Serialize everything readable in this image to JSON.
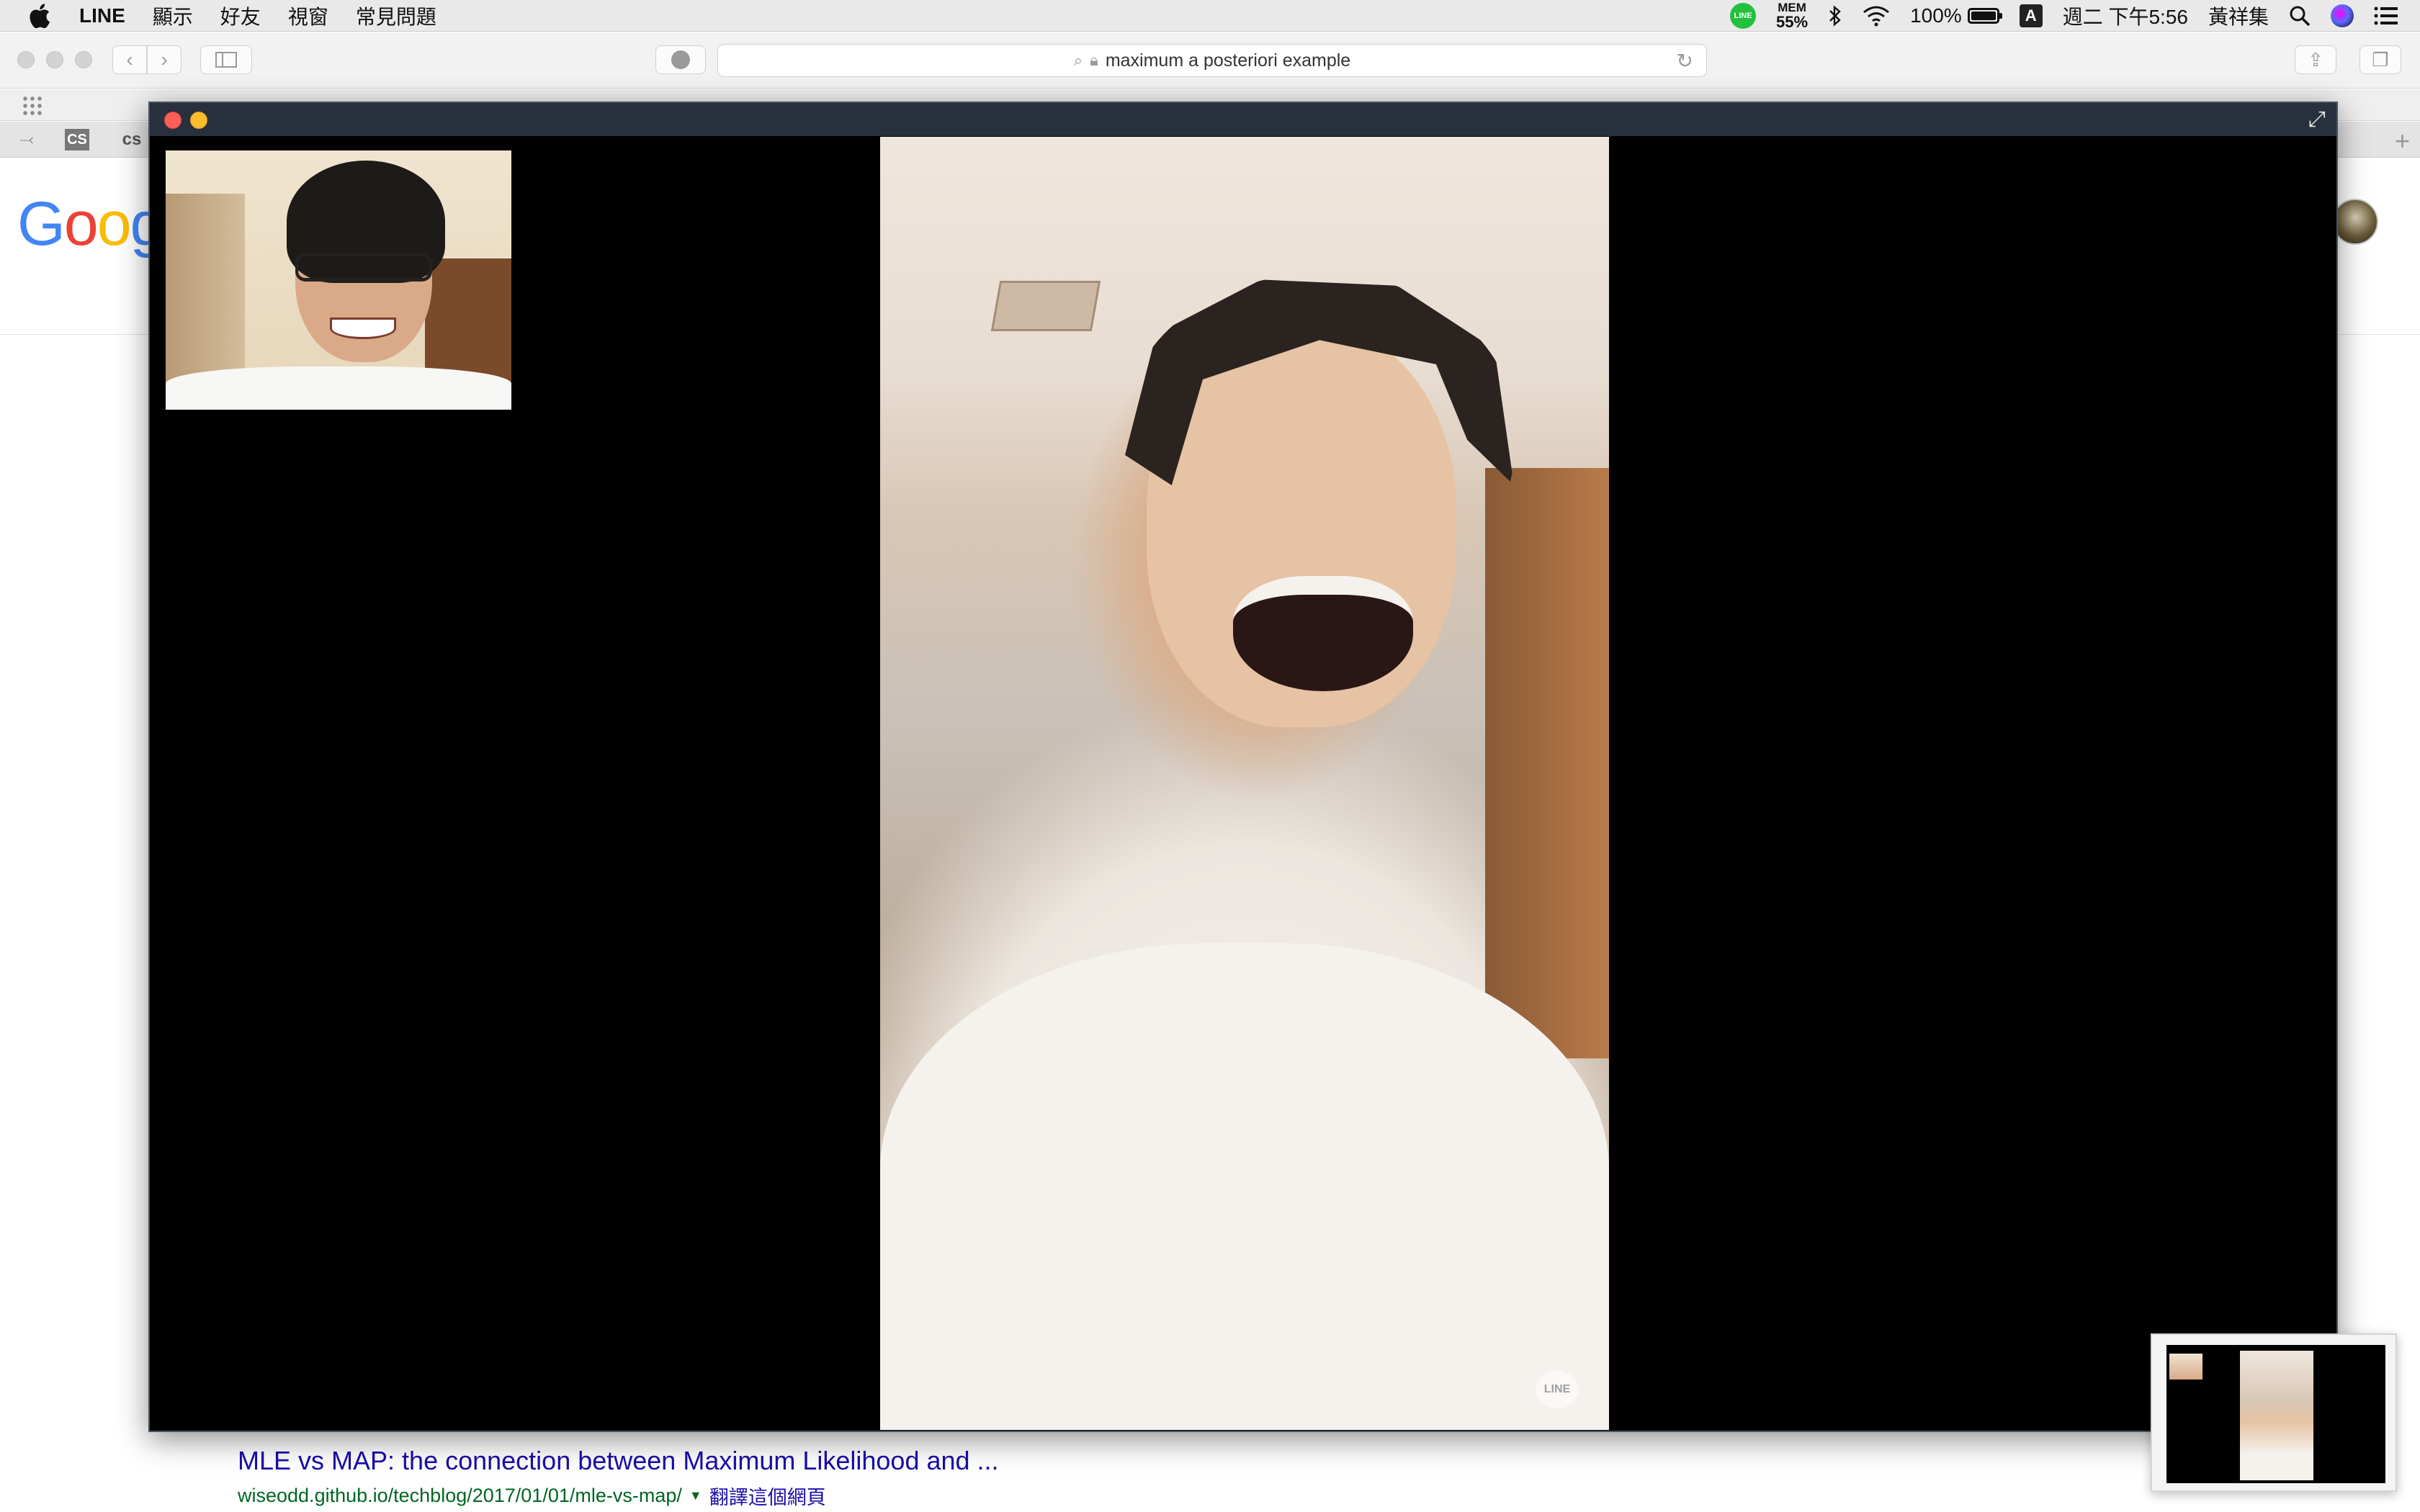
{
  "menubar": {
    "app_name": "LINE",
    "menus": [
      "顯示",
      "好友",
      "視窗",
      "常見問題"
    ],
    "status": {
      "mem_label": "MEM",
      "mem_value": "55%",
      "battery_percent": "100%",
      "battery_level": 1.0,
      "input_source": "A",
      "clock": "週二 下午5:56",
      "user_name": "黃祥集"
    }
  },
  "browser": {
    "address": "maximum a posteriori example",
    "tabs": [
      "CS",
      "cs"
    ],
    "result": {
      "title": "MLE vs MAP: the connection between Maximum Likelihood and ...",
      "url": "wiseodd.github.io/techblog/2017/01/01/mle-vs-map/",
      "translate": "翻譯這個網頁"
    },
    "logo_partial": "Goog"
  },
  "call": {
    "watermark": "LINE"
  }
}
